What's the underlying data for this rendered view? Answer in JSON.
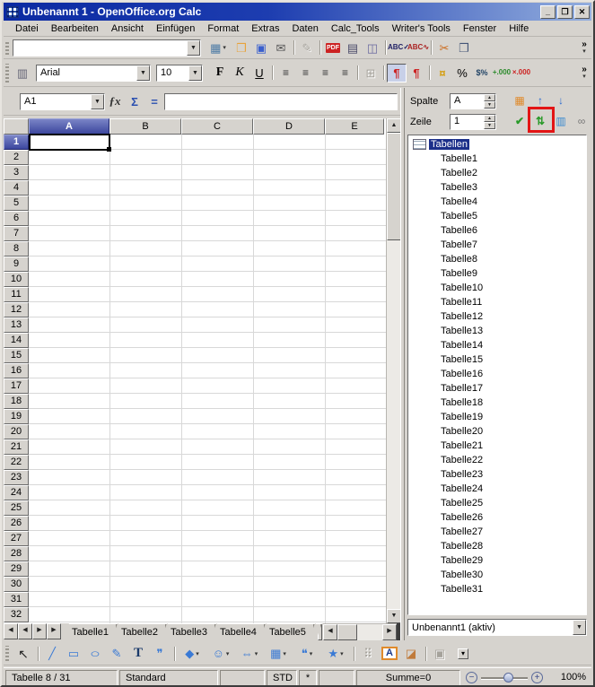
{
  "window": {
    "title": "Unbenannt 1 - OpenOffice.org Calc",
    "controls": {
      "minimize": "_",
      "maximize": "❐",
      "close": "✕"
    }
  },
  "menu": {
    "items": [
      "Datei",
      "Bearbeiten",
      "Ansicht",
      "Einfügen",
      "Format",
      "Extras",
      "Daten",
      "Calc_Tools",
      "Writer's Tools",
      "Fenster",
      "Hilfe"
    ]
  },
  "toolbars": {
    "overflow": {
      "more": "»",
      "caret": "▾"
    },
    "standard": [
      {
        "name": "new-document-icon",
        "g": "▦",
        "cls": "c-new has-caret",
        "ia": "true"
      },
      {
        "name": "open-icon",
        "g": "❒",
        "cls": "c-open",
        "ia": "true"
      },
      {
        "name": "save-icon",
        "g": "▣",
        "cls": "c-save",
        "ia": "true"
      },
      {
        "name": "email-icon",
        "g": "✉",
        "cls": "c-mail",
        "ia": "true"
      },
      {
        "cls": "sep",
        "ia": "false"
      },
      {
        "name": "edit-file-icon",
        "g": "✎",
        "cls": "dis",
        "ia": "false"
      },
      {
        "cls": "sep",
        "ia": "false"
      },
      {
        "name": "pdf-export-icon",
        "g": "PDF",
        "cls": "pdf",
        "ia": "true"
      },
      {
        "name": "print-icon",
        "g": "▤",
        "cls": "c-print",
        "ia": "true"
      },
      {
        "name": "page-preview-icon",
        "g": "◫",
        "cls": "c-prev",
        "ia": "true"
      },
      {
        "cls": "sep",
        "ia": "false"
      },
      {
        "name": "spellcheck-icon",
        "g": "ABC✓",
        "cls": "spell",
        "ia": "true"
      },
      {
        "name": "autospellcheck-icon",
        "g": "ABC∿",
        "cls": "auto",
        "ia": "true"
      },
      {
        "cls": "sep",
        "ia": "false"
      },
      {
        "name": "cut-icon",
        "g": "✂",
        "cls": "c-cut",
        "ia": "true"
      },
      {
        "name": "copy-icon",
        "g": "❐",
        "cls": "c-copy",
        "ia": "true"
      }
    ],
    "formatting": {
      "stylist_glyph": "▥",
      "font_name": "Arial",
      "font_size": "10",
      "buttons": [
        {
          "name": "bold-button",
          "g": "F",
          "cls": "b",
          "ia": "true"
        },
        {
          "name": "italic-button",
          "g": "K",
          "cls": "i",
          "ia": "true"
        },
        {
          "name": "underline-button",
          "g": "U",
          "cls": "u",
          "ia": "true"
        },
        {
          "cls": "sep",
          "ia": "false"
        },
        {
          "name": "align-left-icon",
          "g": "≡",
          "cls": "al",
          "ia": "true"
        },
        {
          "name": "align-center-icon",
          "g": "≡",
          "cls": "al",
          "ia": "true"
        },
        {
          "name": "align-right-icon",
          "g": "≡",
          "cls": "al",
          "ia": "true"
        },
        {
          "name": "align-justify-icon",
          "g": "≡",
          "cls": "al",
          "ia": "true"
        },
        {
          "cls": "sep",
          "ia": "false"
        },
        {
          "name": "merge-cells-icon",
          "g": "⊞",
          "cls": "dis",
          "ia": "false"
        },
        {
          "cls": "sep",
          "ia": "false"
        },
        {
          "name": "text-direction-ltr-icon",
          "g": "¶",
          "cls": "red active",
          "ia": "true"
        },
        {
          "name": "text-direction-rtl-icon",
          "g": "¶",
          "cls": "red",
          "ia": "true"
        },
        {
          "cls": "sep",
          "ia": "false"
        },
        {
          "name": "currency-format-icon",
          "g": "¤",
          "cls": "gold",
          "ia": "true"
        },
        {
          "name": "percent-format-icon",
          "g": "%",
          "cls": "",
          "ia": "true"
        },
        {
          "name": "standard-format-icon",
          "g": "$%",
          "cls": "small",
          "ia": "true"
        },
        {
          "name": "add-decimal-icon",
          "g": "+.000",
          "cls": "tiny green",
          "ia": "true"
        },
        {
          "name": "delete-decimal-icon",
          "g": "×.000",
          "cls": "tiny redx",
          "ia": "true"
        }
      ]
    },
    "drawing": [
      {
        "name": "select-icon",
        "g": "↖",
        "cls": "dark",
        "ia": "true"
      },
      {
        "cls": "sep",
        "ia": "false"
      },
      {
        "name": "line-icon",
        "g": "╱",
        "cls": "blue",
        "ia": "true"
      },
      {
        "name": "rectangle-icon",
        "g": "▭",
        "cls": "blue",
        "ia": "true"
      },
      {
        "name": "ellipse-icon",
        "g": "○",
        "cls": "blue ell",
        "ia": "true"
      },
      {
        "name": "freeform-line-icon",
        "g": "✎",
        "cls": "blue",
        "ia": "true"
      },
      {
        "name": "text-box-icon",
        "g": "T",
        "cls": "tdark",
        "ia": "true"
      },
      {
        "name": "callout-icon",
        "g": "❞",
        "cls": "blue",
        "ia": "true"
      },
      {
        "cls": "sep",
        "ia": "false"
      },
      {
        "name": "basic-shapes-icon",
        "g": "◆",
        "cls": "blue has-caret",
        "ia": "true"
      },
      {
        "name": "symbol-shapes-icon",
        "g": "☺",
        "cls": "blue has-caret",
        "ia": "true"
      },
      {
        "name": "block-arrows-icon",
        "g": "⇔",
        "cls": "blue has-caret",
        "ia": "true"
      },
      {
        "name": "flowcharts-icon",
        "g": "▦",
        "cls": "blue has-caret",
        "ia": "true"
      },
      {
        "name": "callouts-icon",
        "g": "❝",
        "cls": "blue has-caret",
        "ia": "true"
      },
      {
        "name": "stars-icon",
        "g": "★",
        "cls": "blue has-caret",
        "ia": "true"
      },
      {
        "cls": "sep",
        "ia": "false"
      },
      {
        "name": "points-icon",
        "g": "⠿",
        "cls": "dis",
        "ia": "false"
      },
      {
        "name": "fontwork-icon",
        "g": "A",
        "cls": "fontwork",
        "ia": "true"
      },
      {
        "name": "picture-icon",
        "g": "◪",
        "cls": "pic",
        "ia": "true"
      },
      {
        "cls": "sep",
        "ia": "false"
      },
      {
        "name": "extrusion-icon",
        "g": "▣",
        "cls": "dis",
        "ia": "false"
      },
      {
        "name": "toolbar-more-button",
        "g": "▾",
        "cls": "mini",
        "ia": "true"
      }
    ]
  },
  "formula_bar": {
    "cell_ref": "A1",
    "fx_glyph": "ƒx",
    "sum_glyph": "Σ",
    "equals_glyph": "=",
    "value": ""
  },
  "grid": {
    "columns": [
      "A",
      "B",
      "C",
      "D",
      "E"
    ],
    "rows": [
      "1",
      "2",
      "3",
      "4",
      "5",
      "6",
      "7",
      "8",
      "9",
      "10",
      "11",
      "12",
      "13",
      "14",
      "15",
      "16",
      "17",
      "18",
      "19",
      "20",
      "21",
      "22",
      "23",
      "24",
      "25",
      "26",
      "27",
      "28",
      "29",
      "30",
      "31",
      "32"
    ],
    "selected_cell": "A1"
  },
  "sheet_tabs": {
    "nav": [
      {
        "name": "first-sheet-button",
        "g": "◀",
        "ia": "true"
      },
      {
        "name": "prev-sheet-button",
        "g": "◀",
        "ia": "true"
      },
      {
        "name": "next-sheet-button",
        "g": "▶",
        "ia": "true"
      },
      {
        "name": "last-sheet-button",
        "g": "▶",
        "ia": "true"
      }
    ],
    "tabs": [
      "Tabelle1",
      "Tabelle2",
      "Tabelle3",
      "Tabelle4",
      "Tabelle5"
    ]
  },
  "navigator": {
    "column_label": "Spalte",
    "column_value": "A",
    "row_label": "Zeile",
    "row_value": "1",
    "icons_row1": [
      {
        "name": "data-range-icon",
        "g": "▦",
        "cls": "nav-orange",
        "ia": "true"
      },
      {
        "name": "start-icon",
        "g": "↑",
        "cls": "nav-blue",
        "ia": "true"
      },
      {
        "name": "end-icon",
        "g": "↓",
        "cls": "nav-blue",
        "ia": "true"
      }
    ],
    "icons_row2": [
      {
        "name": "contents-icon",
        "g": "✔",
        "cls": "nav-green",
        "ia": "true"
      },
      {
        "name": "toggle-icon",
        "g": "⇅",
        "cls": "nav-green",
        "ia": "true"
      },
      {
        "name": "scenarios-icon",
        "g": "▥",
        "cls": "nav-multi",
        "ia": "true"
      },
      {
        "name": "drag-mode-icon",
        "g": "∞",
        "cls": "nav-gray",
        "ia": "true"
      }
    ],
    "root_label": "Tabellen",
    "sheets": [
      "Tabelle1",
      "Tabelle2",
      "Tabelle3",
      "Tabelle4",
      "Tabelle5",
      "Tabelle6",
      "Tabelle7",
      "Tabelle8",
      "Tabelle9",
      "Tabelle10",
      "Tabelle11",
      "Tabelle12",
      "Tabelle13",
      "Tabelle14",
      "Tabelle15",
      "Tabelle16",
      "Tabelle17",
      "Tabelle18",
      "Tabelle19",
      "Tabelle20",
      "Tabelle21",
      "Tabelle22",
      "Tabelle23",
      "Tabelle24",
      "Tabelle25",
      "Tabelle26",
      "Tabelle27",
      "Tabelle28",
      "Tabelle29",
      "Tabelle30",
      "Tabelle31"
    ],
    "doc_selector": "Unbenannt1 (aktiv)"
  },
  "status_bar": {
    "sheet_info": "Tabelle 8 / 31",
    "page_style": "Standard",
    "mode": "STD",
    "modified": "*",
    "sum": "Summe=0",
    "zoom_out": "−",
    "zoom_in": "+",
    "zoom_level": "100%"
  }
}
